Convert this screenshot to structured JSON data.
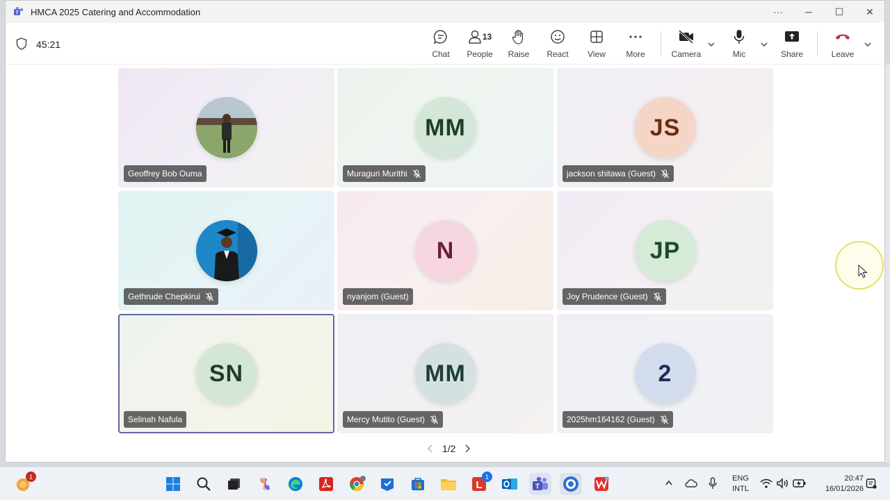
{
  "window": {
    "title": "HMCA 2025 Catering and Accommodation",
    "more_label": "···",
    "minimize_label": "─",
    "maximize_label": "☐",
    "close_label": "✕"
  },
  "meeting": {
    "timer": "45:21",
    "people_count": "13"
  },
  "toolbar": {
    "chat": "Chat",
    "people": "People",
    "raise": "Raise",
    "react": "React",
    "view": "View",
    "more": "More",
    "camera": "Camera",
    "mic": "Mic",
    "share": "Share",
    "leave": "Leave"
  },
  "tiles": [
    {
      "name": "Geoffrey Bob Ouma",
      "initials": "",
      "photo": true,
      "muted": false,
      "bg": "linear-gradient(135deg,#efe6f1,#f1eef6 50%,#f4f1ec)",
      "avatar_bg": "#8aa66a",
      "avatar_color": "#2c3e50"
    },
    {
      "name": "Muraguri Murithi",
      "initials": "MM",
      "photo": false,
      "muted": true,
      "bg": "linear-gradient(135deg,#eef2ee,#eef5ef 50%,#eef2f6)",
      "avatar_bg": "#d3e6d8",
      "avatar_color": "#1d3d2a"
    },
    {
      "name": "jackson shitawa (Guest)",
      "initials": "JS",
      "photo": false,
      "muted": true,
      "bg": "linear-gradient(135deg,#eef0f7,#f3eef2 50%,#f4f2ee)",
      "avatar_bg": "#f5d5c6",
      "avatar_color": "#6b2e14"
    },
    {
      "name": "Gethrude Chepkirui",
      "initials": "",
      "photo": true,
      "muted": true,
      "bg": "linear-gradient(135deg,#dff3f1,#e6f4f5 50%,#eaf0f8)",
      "avatar_bg": "#1f86c8",
      "avatar_color": "#ffffff"
    },
    {
      "name": "nyanjom (Guest)",
      "initials": "N",
      "photo": false,
      "muted": false,
      "bg": "linear-gradient(135deg,#f7eaee,#f8efef 50%,#f7efe6)",
      "avatar_bg": "#f6d6e0",
      "avatar_color": "#6b1e3a"
    },
    {
      "name": "Joy Prudence (Guest)",
      "initials": "JP",
      "photo": false,
      "muted": true,
      "bg": "linear-gradient(135deg,#f1ecf5,#f3eff3 50%,#f0f2ee)",
      "avatar_bg": "#d5ead7",
      "avatar_color": "#1d4a2c"
    },
    {
      "name": "Selinah Nafula",
      "initials": "SN",
      "photo": false,
      "muted": false,
      "bg": "linear-gradient(135deg,#eef3ee,#f2f4ec 50%,#f5f3e6)",
      "avatar_bg": "#d4e6d6",
      "avatar_color": "#1d3d2a"
    },
    {
      "name": "Mercy Mutito (Guest)",
      "initials": "MM",
      "photo": false,
      "muted": true,
      "bg": "linear-gradient(135deg,#eef0f4,#f1f0f3 50%,#f4f1ee)",
      "avatar_bg": "#d5e1e0",
      "avatar_color": "#1d3d3a"
    },
    {
      "name": "2025hm164162 (Guest)",
      "initials": "2",
      "photo": false,
      "muted": true,
      "bg": "linear-gradient(135deg,#eef0f5,#eff1f5 50%,#f1f1f3)",
      "avatar_bg": "#d3dced",
      "avatar_color": "#1d2d5a"
    }
  ],
  "pager": {
    "label": "1/2"
  },
  "taskbar": {
    "weather_badge": "1",
    "outlook_badge": "1",
    "lang_line1": "ENG",
    "lang_line2": "INTL",
    "time": "20:47",
    "date": "16/01/2026"
  },
  "colors": {
    "accent": "#6264a7",
    "leave_red": "#c4314b"
  }
}
